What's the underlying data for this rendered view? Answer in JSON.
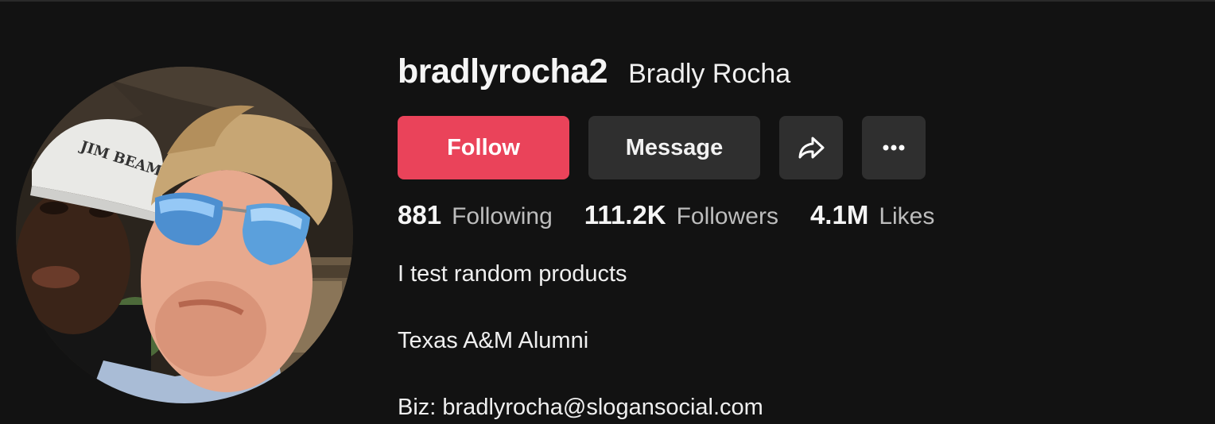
{
  "profile": {
    "username": "bradlyrocha2",
    "nickname": "Bradly Rocha",
    "avatar_cap_text": "JIM BEAM"
  },
  "actions": {
    "follow_label": "Follow",
    "message_label": "Message",
    "share_icon": "share-arrow-icon",
    "more_icon": "more-horizontal-icon"
  },
  "stats": [
    {
      "value": "881",
      "label": "Following"
    },
    {
      "value": "111.2K",
      "label": "Followers"
    },
    {
      "value": "4.1M",
      "label": "Likes"
    }
  ],
  "bio": {
    "line1": "I test random products",
    "line2": "Texas A&M Alumni",
    "line3": "Biz: bradlyrocha@slogansocial.com"
  },
  "colors": {
    "background": "#121212",
    "follow_button": "#ea435a",
    "secondary_button": "#2f2f2f",
    "muted_text": "#bdbdbd"
  }
}
